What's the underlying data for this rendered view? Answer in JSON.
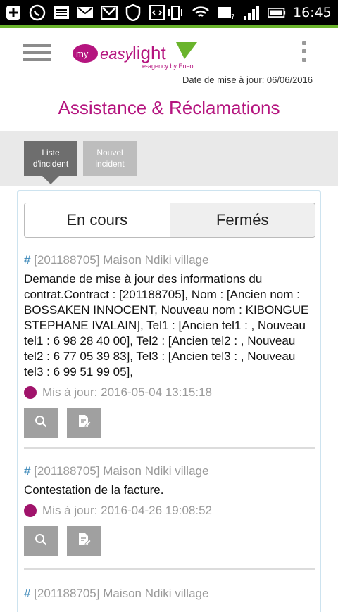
{
  "statusbar": {
    "time": "16:45",
    "battery_icon": "battery-icon",
    "signal_icon": "signal-icon",
    "wifi_icon": "wifi-icon"
  },
  "header": {
    "brand_prefix": "my",
    "brand_easy": "easy",
    "brand_light": "light",
    "brand_tagline": "e-agency by Eneo",
    "updated": "Date de mise à jour: 06/06/2016"
  },
  "page": {
    "title": "Assistance & Réclamations"
  },
  "tabs": {
    "list_line1": "Liste",
    "list_line2": "d'incident",
    "new_line1": "Nouvel",
    "new_line2": "incident"
  },
  "segment": {
    "open": "En cours",
    "closed": "Fermés"
  },
  "incidents": [
    {
      "hash": "#",
      "ref": "[201188705] Maison Ndiki village",
      "description": "Demande de mise à jour des informations du contrat.Contract : [201188705], Nom : [Ancien nom : BOSSAKEN INNOCENT, Nouveau nom : KIBONGUE STEPHANE IVALAIN], Tel1 : [Ancien tel1 : , Nouveau tel1 : 6 98 28 40 00], Tel2 : [Ancien tel2 : , Nouveau tel2 : 6 77 05 39 83], Tel3 : [Ancien tel3 : , Nouveau tel3 : 6 99 51 99 05],",
      "updated": "Mis à jour: 2016-05-04 13:15:18"
    },
    {
      "hash": "#",
      "ref": "[201188705] Maison Ndiki village",
      "description": "Contestation de la facture.",
      "updated": "Mis à jour: 2016-04-26 19:08:52"
    },
    {
      "hash": "#",
      "ref": "[201188705] Maison Ndiki village"
    }
  ],
  "colors": {
    "brand": "#b5157f",
    "dot": "#a0136b",
    "accent_green": "#6ab42c"
  }
}
